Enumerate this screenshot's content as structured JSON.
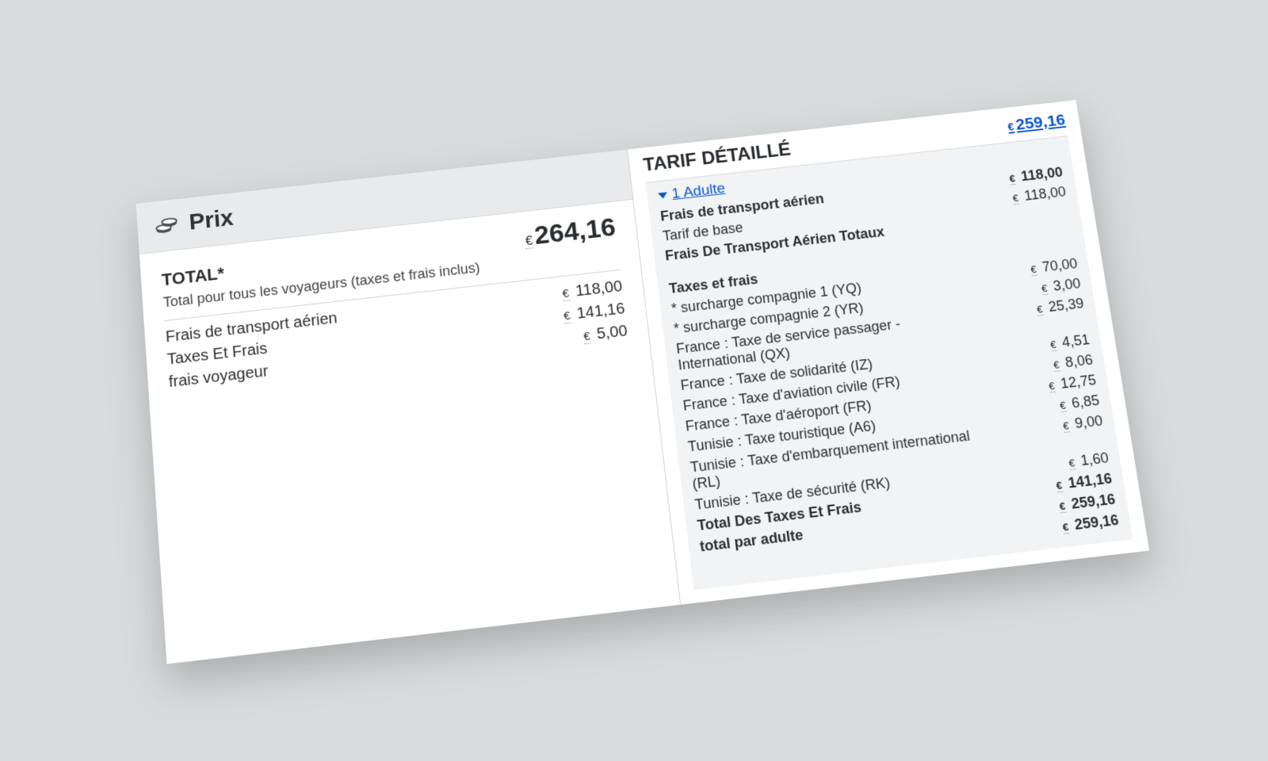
{
  "left": {
    "header": "Prix",
    "total_label": "TOTAL*",
    "total_currency": "€",
    "total_value": "264,16",
    "total_note": "Total pour tous les voyageurs (taxes et frais inclus)",
    "items": [
      {
        "label": "Frais de transport aérien",
        "currency": "€",
        "value": "118,00"
      },
      {
        "label": "Taxes Et Frais",
        "currency": "€",
        "value": "141,16"
      },
      {
        "label": "frais voyageur",
        "currency": "€",
        "value": "5,00"
      }
    ]
  },
  "right": {
    "title": "TARIF DÉTAILLÉ",
    "grand_link": {
      "currency": "€",
      "value": "259,16"
    },
    "pax_label": "1 Adulte",
    "rows": [
      {
        "label": "Frais de transport aérien",
        "currency": "€",
        "value": "118,00",
        "bold": true
      },
      {
        "label": "Tarif de base",
        "currency": "€",
        "value": "118,00"
      },
      {
        "label": "Frais De Transport Aérien Totaux",
        "bold": true
      },
      {
        "spacer": true
      },
      {
        "label": "Taxes et frais",
        "bold": true
      },
      {
        "label": "* surcharge compagnie 1 (YQ)",
        "currency": "€",
        "value": "70,00"
      },
      {
        "label": "* surcharge compagnie 2 (YR)",
        "currency": "€",
        "value": "3,00"
      },
      {
        "label": "France : Taxe de service passager - International (QX)",
        "currency": "€",
        "value": "25,39"
      },
      {
        "label": "France : Taxe de solidarité (IZ)",
        "currency": "€",
        "value": "4,51"
      },
      {
        "label": "France : Taxe d'aviation civile (FR)",
        "currency": "€",
        "value": "8,06"
      },
      {
        "label": "France : Taxe d'aéroport (FR)",
        "currency": "€",
        "value": "12,75"
      },
      {
        "label": "Tunisie : Taxe touristique (A6)",
        "currency": "€",
        "value": "6,85"
      },
      {
        "label": "Tunisie : Taxe d'embarquement international (RL)",
        "currency": "€",
        "value": "9,00"
      },
      {
        "label": "Tunisie : Taxe de sécurité (RK)",
        "currency": "€",
        "value": "1,60"
      },
      {
        "label": "Total Des Taxes Et Frais",
        "currency": "€",
        "value": "141,16",
        "bold": true
      },
      {
        "label": "total par adulte",
        "currency": "€",
        "value": "259,16",
        "bold": true
      },
      {
        "label": "",
        "currency": "€",
        "value": "259,16",
        "bold": true
      }
    ]
  }
}
